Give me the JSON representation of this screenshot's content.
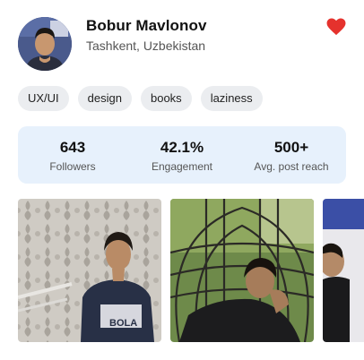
{
  "profile": {
    "name": "Bobur Mavlonov",
    "location": "Tashkent, Uzbekistan",
    "liked": true,
    "like_color": "#e5322d"
  },
  "tags": [
    "UX/UI",
    "design",
    "books",
    "laziness"
  ],
  "stats": [
    {
      "value": "643",
      "label": "Followers"
    },
    {
      "value": "42.1%",
      "label": "Engagement"
    },
    {
      "value": "500+",
      "label": "Avg. post reach"
    }
  ],
  "gallery": {
    "photo_count_visible": 3
  },
  "colors": {
    "stats_bg": "#e7f1fc",
    "tag_bg": "#ebedf0"
  }
}
